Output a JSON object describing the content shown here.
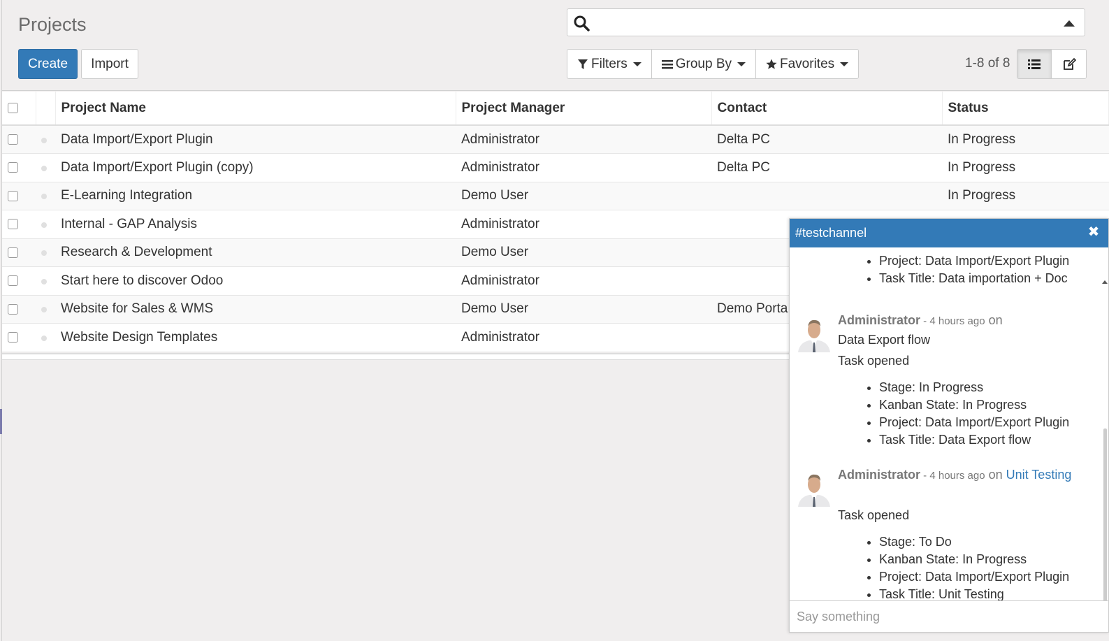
{
  "header": {
    "title": "Projects",
    "create_label": "Create",
    "import_label": "Import"
  },
  "search": {
    "placeholder": ""
  },
  "filters": {
    "filters_label": "Filters",
    "groupby_label": "Group By",
    "favorites_label": "Favorites"
  },
  "pager": {
    "text": "1-8 of 8"
  },
  "table": {
    "columns": [
      "Project Name",
      "Project Manager",
      "Contact",
      "Status"
    ],
    "rows": [
      {
        "name": "Data Import/Export Plugin",
        "manager": "Administrator",
        "contact": "Delta PC",
        "status": "In Progress"
      },
      {
        "name": "Data Import/Export Plugin (copy)",
        "manager": "Administrator",
        "contact": "Delta PC",
        "status": "In Progress"
      },
      {
        "name": "E-Learning Integration",
        "manager": "Demo User",
        "contact": "",
        "status": "In Progress"
      },
      {
        "name": "Internal - GAP Analysis",
        "manager": "Administrator",
        "contact": "",
        "status": ""
      },
      {
        "name": "Research & Development",
        "manager": "Demo User",
        "contact": "",
        "status": ""
      },
      {
        "name": "Start here to discover Odoo",
        "manager": "Administrator",
        "contact": "",
        "status": ""
      },
      {
        "name": "Website for Sales & WMS",
        "manager": "Demo User",
        "contact": "Demo Porta",
        "status": ""
      },
      {
        "name": "Website Design Templates",
        "manager": "Administrator",
        "contact": "",
        "status": ""
      }
    ]
  },
  "chat": {
    "channel": "#testchannel",
    "close_symbol": "✖",
    "top_items": [
      "Project: Data Import/Export Plugin",
      "Task Title: Data importation + Doc"
    ],
    "messages": [
      {
        "author": "Administrator",
        "time": " - 4 hours ago",
        "on": " on",
        "link": "Data Export flow",
        "text": "Task opened",
        "items": [
          "Stage: In Progress",
          "Kanban State: In Progress",
          "Project: Data Import/Export Plugin",
          "Task Title: Data Export flow"
        ]
      },
      {
        "author": "Administrator",
        "time": " - 4 hours ago",
        "on": " on",
        "link": "Unit Testing",
        "text": "Task opened",
        "items": [
          "Stage: To Do",
          "Kanban State: In Progress",
          "Project: Data Import/Export Plugin",
          "Task Title: Unit Testing"
        ]
      }
    ],
    "input_placeholder": "Say something"
  },
  "colors": {
    "primary": "#337ab7",
    "accent": "#7c7bad"
  }
}
